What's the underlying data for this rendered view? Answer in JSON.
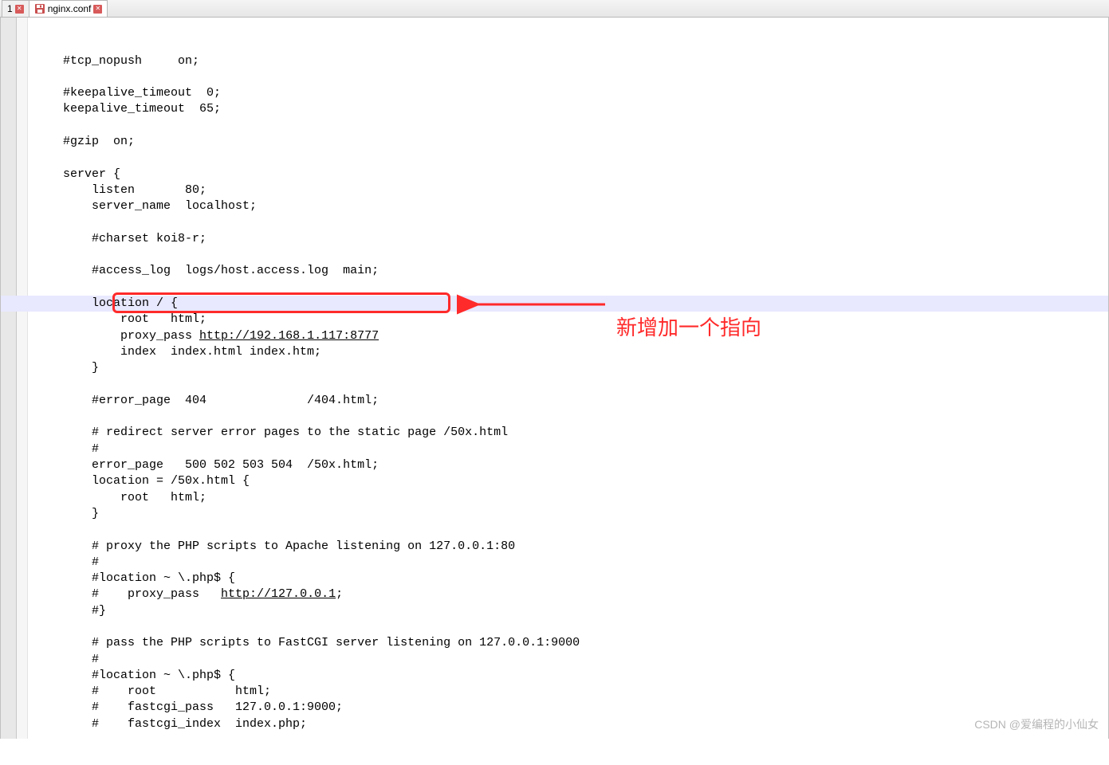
{
  "tabs": {
    "tab1_label": "1",
    "tab2_label": "nginx.conf"
  },
  "code": {
    "lines": [
      "    #tcp_nopush     on;",
      "",
      "    #keepalive_timeout  0;",
      "    keepalive_timeout  65;",
      "",
      "    #gzip  on;",
      "",
      "    server {",
      "        listen       80;",
      "        server_name  localhost;",
      "",
      "        #charset koi8-r;",
      "",
      "        #access_log  logs/host.access.log  main;",
      "",
      "        location / {",
      "            root   html;",
      "            proxy_pass ",
      "            index  index.html index.htm;",
      "        }",
      "",
      "        #error_page  404              /404.html;",
      "",
      "        # redirect server error pages to the static page /50x.html",
      "        #",
      "        error_page   500 502 503 504  /50x.html;",
      "        location = /50x.html {",
      "            root   html;",
      "        }",
      "",
      "        # proxy the PHP scripts to Apache listening on 127.0.0.1:80",
      "        #",
      "        #location ~ \\.php$ {",
      "        #    proxy_pass   ",
      "        #}",
      "",
      "        # pass the PHP scripts to FastCGI server listening on 127.0.0.1:9000",
      "        #",
      "        #location ~ \\.php$ {",
      "        #    root           html;",
      "        #    fastcgi_pass   127.0.0.1:9000;",
      "        #    fastcgi_index  index.php;"
    ],
    "proxy_url": "http://192.168.1.117:8777",
    "proxy_url2": "http://127.0.0.1",
    "proxy_url2_suffix": ";"
  },
  "annotation": {
    "text": "新增加一个指向"
  },
  "watermark": "CSDN @爱编程的小仙女"
}
